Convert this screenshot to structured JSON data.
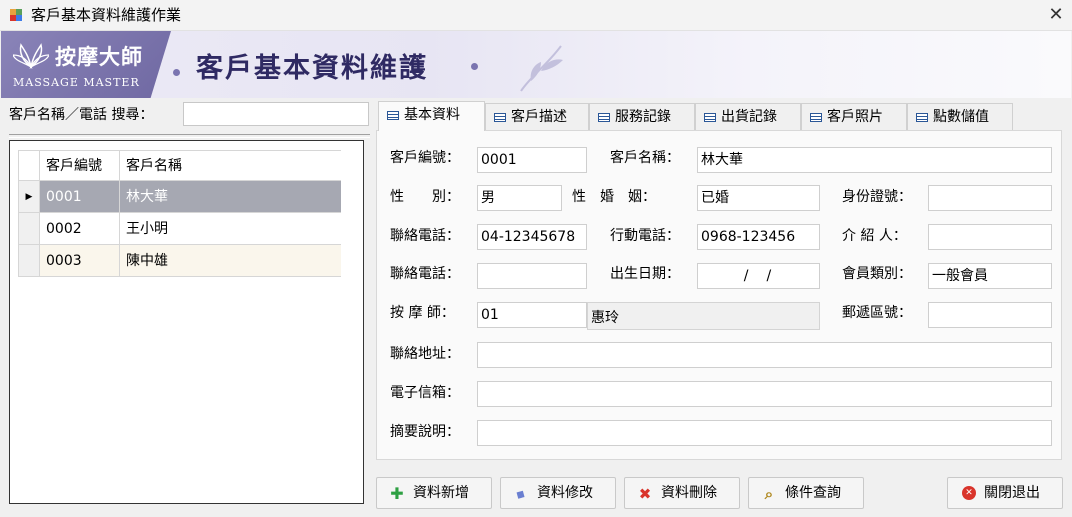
{
  "window": {
    "title": "客戶基本資料維護作業",
    "close_glyph": "✕"
  },
  "banner": {
    "logo_cn": "按摩大師",
    "logo_en": "MASSAGE MASTER",
    "title": "客戶基本資料維護",
    "colors": {
      "logo_bg": "#7a74b0",
      "title": "#2f2a63"
    }
  },
  "search": {
    "label": "客戶名稱／電話 搜尋：",
    "value": ""
  },
  "grid": {
    "columns": [
      "客戶編號",
      "客戶名稱"
    ],
    "rows": [
      {
        "id": "0001",
        "name": "林大華",
        "selected": true
      },
      {
        "id": "0002",
        "name": "王小明",
        "selected": false
      },
      {
        "id": "0003",
        "name": "陳中雄",
        "selected": false
      }
    ],
    "colors": {
      "selected_row": "#a6a8b2",
      "alt_row": "#faf6ec"
    }
  },
  "tabs": [
    {
      "label": "基本資料",
      "active": true
    },
    {
      "label": "客戶描述",
      "active": false
    },
    {
      "label": "服務記錄",
      "active": false
    },
    {
      "label": "出貨記錄",
      "active": false
    },
    {
      "label": "客戶照片",
      "active": false
    },
    {
      "label": "點數儲值",
      "active": false
    }
  ],
  "form": {
    "customer_id": {
      "label": "客戶編號：",
      "value": "0001"
    },
    "customer_name": {
      "label": "客戶名稱：",
      "value": "林大華"
    },
    "gender": {
      "label": "性　　別：",
      "value": "男"
    },
    "marital": {
      "label": "性　婚　姻：",
      "value": "已婚"
    },
    "id_number": {
      "label": "身份證號：",
      "value": ""
    },
    "phone": {
      "label": "聯絡電話：",
      "value": "04-12345678"
    },
    "mobile": {
      "label": "行動電話：",
      "value": "0968-123456"
    },
    "referrer": {
      "label": "介 紹 人：",
      "value": ""
    },
    "phone2": {
      "label": "聯絡電話：",
      "value": ""
    },
    "birthday": {
      "label": "出生日期：",
      "value": "/　/"
    },
    "member_type": {
      "label": "會員類別：",
      "value": "一般會員"
    },
    "therapist": {
      "label": "按 摩 師：",
      "code": "01",
      "name": "惠玲"
    },
    "zip": {
      "label": "郵遞區號：",
      "value": ""
    },
    "address": {
      "label": "聯絡地址：",
      "value": ""
    },
    "email": {
      "label": "電子信箱：",
      "value": ""
    },
    "note": {
      "label": "摘要說明：",
      "value": ""
    }
  },
  "buttons": {
    "add": {
      "label": "資料新增",
      "icon": "plus-icon",
      "glyph": "✚",
      "color": "#2ea043"
    },
    "edit": {
      "label": "資料修改",
      "icon": "eraser-icon",
      "glyph": "◆",
      "color": "#6a7fd1"
    },
    "delete": {
      "label": "資料刪除",
      "icon": "delete-x-icon",
      "glyph": "✖",
      "color": "#d9342b"
    },
    "query": {
      "label": "條件查詢",
      "icon": "magnifier-icon",
      "glyph": "⌕",
      "color": "#b08a22"
    },
    "exit": {
      "label": "關閉退出",
      "icon": "close-circle-icon",
      "glyph": "✕",
      "color": "#d9342b"
    }
  }
}
